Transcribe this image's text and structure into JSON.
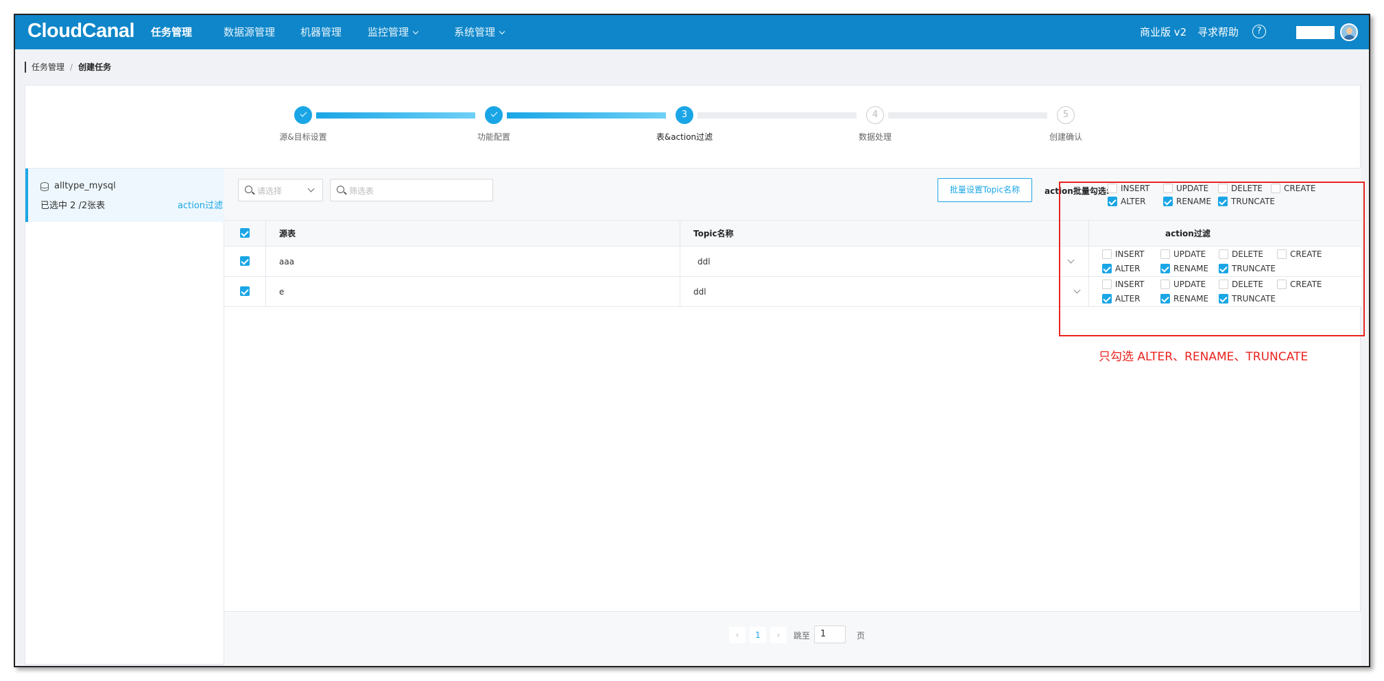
{
  "app": {
    "logo": "CloudCanal",
    "nav": [
      {
        "label": "任务管理",
        "active": true
      },
      {
        "label": "数据源管理"
      },
      {
        "label": "机器管理"
      },
      {
        "label": "监控管理",
        "dropdown": true
      },
      {
        "label": "系统管理",
        "dropdown": true
      }
    ],
    "edition": "商业版 v2",
    "help": "寻求帮助",
    "help_icon": "?"
  },
  "breadcrumb": {
    "parent": "任务管理",
    "separator": "/",
    "current": "创建任务"
  },
  "steps": [
    {
      "label": "源&目标设置",
      "status": "done"
    },
    {
      "label": "功能配置",
      "status": "done"
    },
    {
      "label": "表&action过滤",
      "status": "current",
      "number": "3"
    },
    {
      "label": "数据处理",
      "status": "todo",
      "number": "4"
    },
    {
      "label": "创建确认",
      "status": "todo",
      "number": "5"
    }
  ],
  "datasource": {
    "name": "alltype_mysql",
    "selected": "已选中 2 /2张表",
    "link": "action过滤"
  },
  "toolbar": {
    "select_placeholder": "请选择",
    "filter_placeholder": "筛选表",
    "batch_topic_button": "批量设置Topic名称",
    "batch_action_label": "action批量勾选:",
    "batch_actions": [
      {
        "label": "INSERT",
        "checked": false
      },
      {
        "label": "UPDATE",
        "checked": false
      },
      {
        "label": "DELETE",
        "checked": false
      },
      {
        "label": "CREATE",
        "checked": false
      },
      {
        "label": "ALTER",
        "checked": true
      },
      {
        "label": "RENAME",
        "checked": true
      },
      {
        "label": "TRUNCATE",
        "checked": true
      }
    ]
  },
  "table": {
    "headers": {
      "source": "源表",
      "topic": "Topic名称",
      "action": "action过滤"
    },
    "select_all": true,
    "rows": [
      {
        "checked": true,
        "source": "aaa",
        "topic": "ddl",
        "actions": [
          {
            "label": "INSERT",
            "checked": false
          },
          {
            "label": "UPDATE",
            "checked": false
          },
          {
            "label": "DELETE",
            "checked": false
          },
          {
            "label": "CREATE",
            "checked": false
          },
          {
            "label": "ALTER",
            "checked": true
          },
          {
            "label": "RENAME",
            "checked": true
          },
          {
            "label": "TRUNCATE",
            "checked": true
          }
        ]
      },
      {
        "checked": true,
        "source": "e",
        "topic": "ddl",
        "actions": [
          {
            "label": "INSERT",
            "checked": false
          },
          {
            "label": "UPDATE",
            "checked": false
          },
          {
            "label": "DELETE",
            "checked": false
          },
          {
            "label": "CREATE",
            "checked": false
          },
          {
            "label": "ALTER",
            "checked": true
          },
          {
            "label": "RENAME",
            "checked": true
          },
          {
            "label": "TRUNCATE",
            "checked": true
          }
        ]
      }
    ]
  },
  "pagination": {
    "prev": "‹",
    "current": "1",
    "next": "›",
    "jump_label": "跳至",
    "jump_value": "1",
    "page_unit": "页"
  },
  "annotation": {
    "text": "只勾选 ALTER、RENAME、TRUNCATE",
    "color": "#e8231f"
  },
  "colors": {
    "brand": "#0e86c9",
    "accent": "#1aa6e6"
  }
}
